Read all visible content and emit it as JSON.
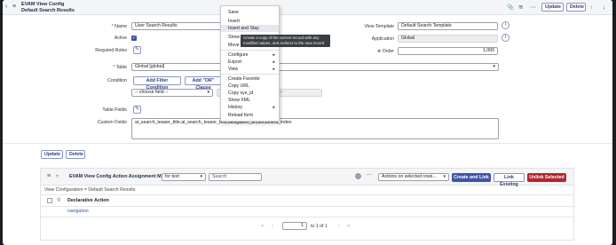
{
  "header": {
    "title": "EVAM View Config",
    "subtitle": "Default Search Results",
    "update_label": "Update",
    "delete_label": "Delete"
  },
  "form": {
    "name_label": "Name",
    "name_value": "User Search Results",
    "active_label": "Active",
    "required_roles_label": "Required Roles",
    "table_label": "Table",
    "table_value": "Global [global]",
    "condition_label": "Condition",
    "add_filter_label": "Add Filter Condition",
    "add_or_label": "Add \"OR\" Clause",
    "choose_field": "-- choose field --",
    "value_partial": "ue --",
    "table_fields_label": "Table Fields",
    "custom_fields_label": "Custom Fields",
    "custom_fields_value": "ai_search_teaser_title,ai_search_teaser_text,navigation_url,document_index",
    "view_template_label": "View Template",
    "view_template_value": "Default Search Template",
    "application_label": "Application",
    "application_value": "Global",
    "order_label": "Order",
    "order_value": "1,000"
  },
  "context_menu": {
    "items": [
      "Save",
      "Insert",
      "Insert and Stay",
      "Show",
      "Move",
      "Configure",
      "Export",
      "View",
      "Create Favorite",
      "Copy URL",
      "Copy sys_id",
      "Show XML",
      "History",
      "Reload form"
    ],
    "tooltip": "Create a copy of the current record with any modified values, and redirect to the new record"
  },
  "footer_buttons": {
    "update_label": "Update",
    "delete_label": "Delete"
  },
  "related_list": {
    "title": "EVAM View Config Action Assignment M2Ms",
    "filter_select": "for text",
    "search_placeholder": "Search",
    "actions_select": "Actions on selected rows...",
    "create_link_label": "Create and Link",
    "link_existing_label": "Link Existing",
    "unlink_selected_label": "Unlink Selected",
    "breadcrumb": "View Configuration = Default Search Results",
    "column_header": "Declarative Action",
    "rows": [
      "navigation"
    ],
    "pagination": {
      "page": "1",
      "of_text": "to 1 of 1"
    }
  },
  "colors": {
    "primary": "#3d55a8",
    "danger": "#b3262c",
    "header_bg": "#f4f5f7"
  }
}
